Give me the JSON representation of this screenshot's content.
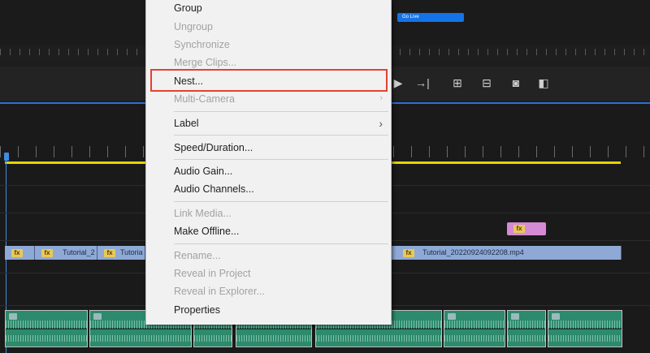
{
  "go_live": {
    "label": "Go Live"
  },
  "video_track": {
    "clips": [
      {
        "label": ""
      },
      {
        "label": "Tutorial_2"
      },
      {
        "label": "Tutoria"
      },
      {
        "label": "Tutorial_20220924092208.mp4"
      }
    ],
    "fx_badge": "fx"
  },
  "context_menu": {
    "items": [
      {
        "label": "Group",
        "enabled": true
      },
      {
        "label": "Ungroup",
        "enabled": false
      },
      {
        "label": "Synchronize",
        "enabled": false
      },
      {
        "label": "Merge Clips...",
        "enabled": false
      },
      {
        "label": "Nest...",
        "enabled": true,
        "highlighted": true
      },
      {
        "label": "Multi-Camera",
        "enabled": false,
        "submenu": true
      },
      {
        "label": "Label",
        "enabled": true,
        "submenu": true
      },
      {
        "label": "Speed/Duration...",
        "enabled": true
      },
      {
        "label": "Audio Gain...",
        "enabled": true
      },
      {
        "label": "Audio Channels...",
        "enabled": true
      },
      {
        "label": "Link Media...",
        "enabled": false
      },
      {
        "label": "Make Offline...",
        "enabled": true
      },
      {
        "label": "Rename...",
        "enabled": false
      },
      {
        "label": "Reveal in Project",
        "enabled": false
      },
      {
        "label": "Reveal in Explorer...",
        "enabled": false
      },
      {
        "label": "Properties",
        "enabled": true
      }
    ],
    "submenu_glyph": "›"
  },
  "colors": {
    "highlight": "#e4412e",
    "playhead": "#3f8ce0",
    "work_area": "#e6d400",
    "video_clip": "#8ea9d6",
    "audio_clip": "#2d8a6c"
  }
}
